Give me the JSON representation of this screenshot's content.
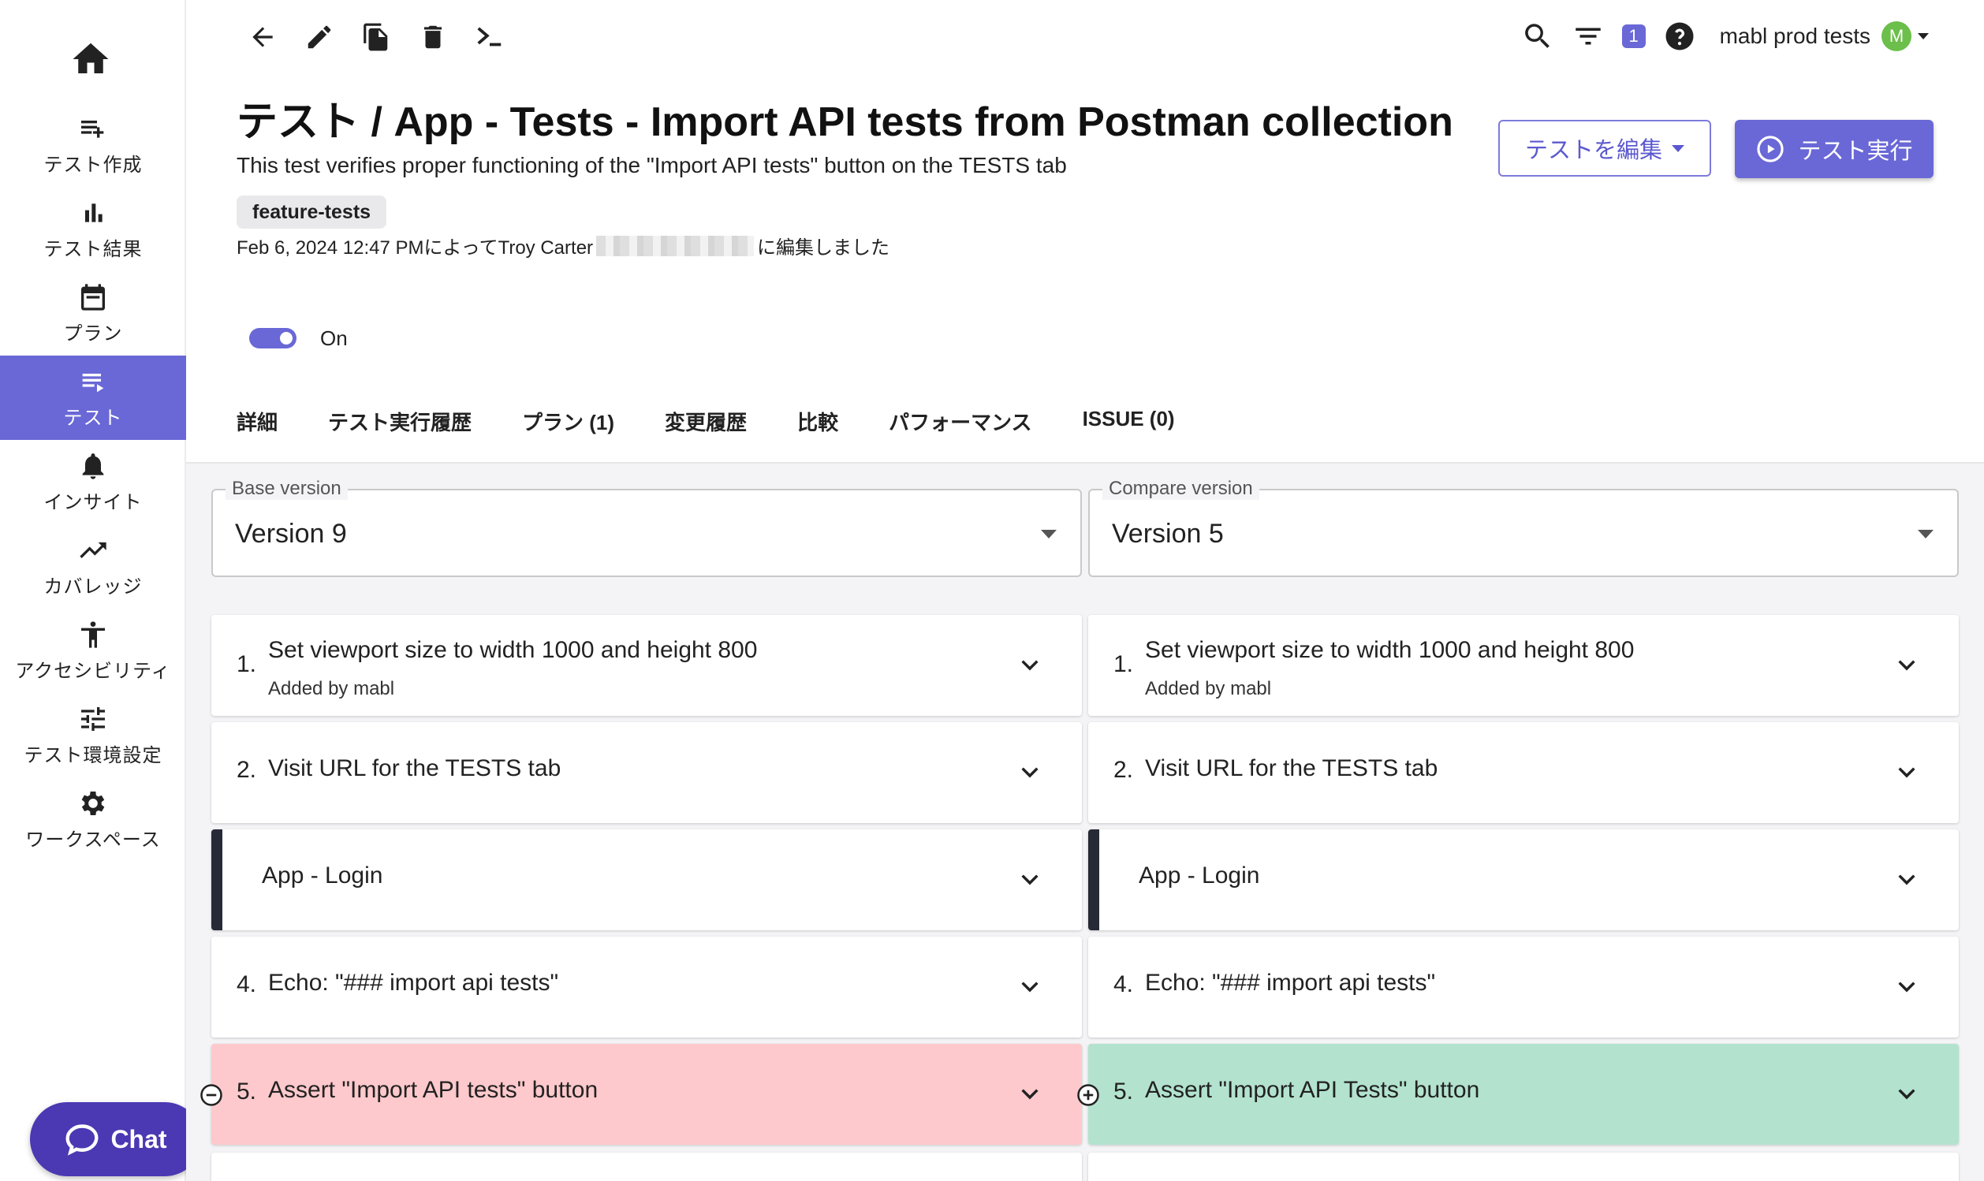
{
  "sidebar": {
    "home_icon": "home-icon",
    "items": [
      {
        "label": "テスト作成",
        "icon": "playlist-add-icon",
        "active": false
      },
      {
        "label": "テスト結果",
        "icon": "bar-chart-icon",
        "active": false
      },
      {
        "label": "プラン",
        "icon": "calendar-icon",
        "active": false
      },
      {
        "label": "テスト",
        "icon": "playlist-play-icon",
        "active": true
      },
      {
        "label": "インサイト",
        "icon": "bell-icon",
        "active": false
      },
      {
        "label": "カバレッジ",
        "icon": "trending-up-icon",
        "active": false
      },
      {
        "label": "アクセシビリティ",
        "icon": "accessibility-icon",
        "active": false
      },
      {
        "label": "テスト環境設定",
        "icon": "tune-icon",
        "active": false
      },
      {
        "label": "ワークスペース",
        "icon": "gear-icon",
        "active": false
      }
    ],
    "chat_label": "Chat"
  },
  "topbar": {
    "filter_count": "1",
    "org_name": "mabl prod tests",
    "avatar_initial": "M"
  },
  "header": {
    "title": "テスト / App - Tests - Import API tests from Postman collection",
    "description": "This test verifies proper functioning of the \"Import API tests\" button on the TESTS tab",
    "tag": "feature-tests",
    "edited_prefix": "Feb 6, 2024 12:47 PMによってTroy Carter",
    "edited_suffix": "に編集しました",
    "edit_button": "テストを編集",
    "run_button": "テスト実行",
    "toggle_label": "On"
  },
  "tabs": [
    "詳細",
    "テスト実行履歴",
    "プラン (1)",
    "変更履歴",
    "比較",
    "パフォーマンス",
    "ISSUE (0)"
  ],
  "compare": {
    "base": {
      "legend": "Base version",
      "value": "Version 9"
    },
    "compare": {
      "legend": "Compare version",
      "value": "Version 5"
    },
    "left_steps": [
      {
        "num": "1.",
        "text": "Set viewport size to width 1000 and height 800",
        "sub": "Added by mabl",
        "kind": "normal"
      },
      {
        "num": "2.",
        "text": "Visit URL for the TESTS tab",
        "sub": "",
        "kind": "normal"
      },
      {
        "num": "",
        "text": "App - Login",
        "sub": "",
        "kind": "group"
      },
      {
        "num": "4.",
        "text": "Echo: \"### import api tests\"",
        "sub": "",
        "kind": "normal"
      },
      {
        "num": "5.",
        "text": "Assert \"Import API tests\" button",
        "sub": "",
        "kind": "removed"
      }
    ],
    "right_steps": [
      {
        "num": "1.",
        "text": "Set viewport size to width 1000 and height 800",
        "sub": "Added by mabl",
        "kind": "normal"
      },
      {
        "num": "2.",
        "text": "Visit URL for the TESTS tab",
        "sub": "",
        "kind": "normal"
      },
      {
        "num": "",
        "text": "App - Login",
        "sub": "",
        "kind": "group"
      },
      {
        "num": "4.",
        "text": "Echo: \"### import api tests\"",
        "sub": "",
        "kind": "normal"
      },
      {
        "num": "5.",
        "text": "Assert \"Import API Tests\" button",
        "sub": "",
        "kind": "added"
      }
    ]
  },
  "colors": {
    "accent": "#6a68d6",
    "removed": "#fec9cc",
    "added": "#b3e3cf",
    "chat": "#4b38b3"
  }
}
